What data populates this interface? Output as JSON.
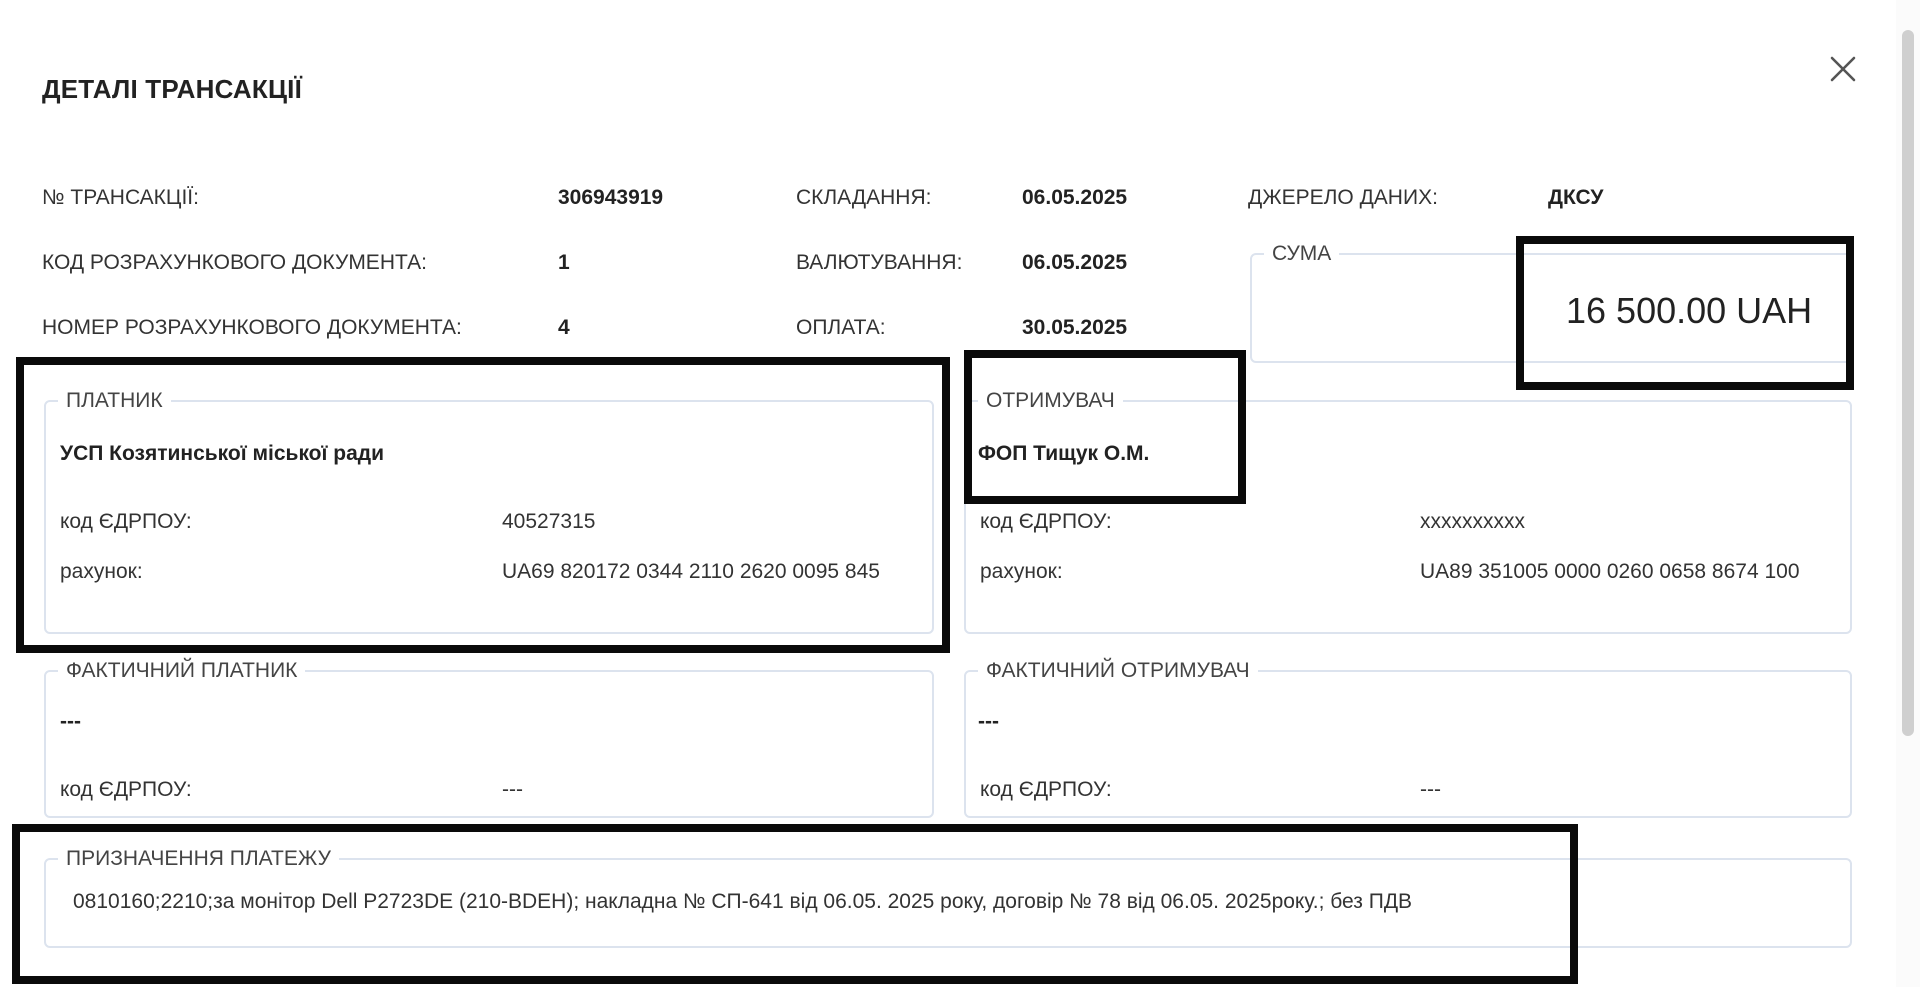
{
  "modal": {
    "title": "ДЕТАЛІ ТРАНСАКЦІЇ",
    "close_icon": "close-icon"
  },
  "details": {
    "transaction_no_label": "№ ТРАНСАКЦІЇ:",
    "transaction_no": "306943919",
    "doc_code_label": "КОД РОЗРАХУНКОВОГО ДОКУМЕНТА:",
    "doc_code": "1",
    "doc_number_label": "НОМЕР РОЗРАХУНКОВОГО ДОКУМЕНТА:",
    "doc_number": "4",
    "compiled_label": "СКЛАДАННЯ:",
    "compiled_date": "06.05.2025",
    "valuation_label": "ВАЛЮТУВАННЯ:",
    "valuation_date": "06.05.2025",
    "payment_label": "ОПЛАТА:",
    "payment_date": "30.05.2025",
    "source_label": "ДЖЕРЕЛО ДАНИХ:",
    "source": "ДКСУ"
  },
  "amount": {
    "legend": "СУМА",
    "value": "16 500.00 UAH"
  },
  "payer": {
    "legend": "ПЛАТНИК",
    "name": "УСП Козятинської міської ради",
    "edrpou_label": "код ЄДРПОУ:",
    "edrpou": "40527315",
    "account_label": "рахунок:",
    "account": "UA69 820172 0344 2110 2620 0095 845"
  },
  "receiver": {
    "legend": "ОТРИМУВАЧ",
    "name": "ФОП Тищук О.М.",
    "edrpou_label": "код ЄДРПОУ:",
    "edrpou": "xxxxxxxxxx",
    "account_label": "рахунок:",
    "account": "UA89 351005 0000 0260 0658 8674 100"
  },
  "actual_payer": {
    "legend": "ФАКТИЧНИЙ ПЛАТНИК",
    "name": "---",
    "edrpou_label": "код ЄДРПОУ:",
    "edrpou": "---"
  },
  "actual_receiver": {
    "legend": "ФАКТИЧНИЙ ОТРИМУВАЧ",
    "name": "---",
    "edrpou_label": "код ЄДРПОУ:",
    "edrpou": "---"
  },
  "purpose": {
    "legend": "ПРИЗНАЧЕННЯ ПЛАТЕЖУ",
    "text": "0810160;2210;за монітор Dell P2723DE (210-BDEH); накладна № СП-641 від 06.05. 2025 року, договір № 78 від 06.05. 2025року.; без ПДВ"
  },
  "colors": {
    "box_border": "#dce3ee",
    "highlight": "#0a0a0a",
    "text": "#222222"
  }
}
